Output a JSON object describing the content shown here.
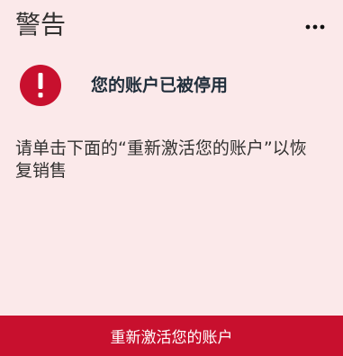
{
  "card": {
    "title": "警告",
    "more_icon": "more-horizontal-icon"
  },
  "alert": {
    "icon": "exclamation-icon",
    "heading": "您的账户已被停用",
    "icon_color": "#c8102e"
  },
  "message": {
    "text": "请单击下面的“重新激活您的账户”以恢复销售"
  },
  "action": {
    "label": "重新激活您的账户",
    "color": "#c8102e"
  },
  "colors": {
    "background": "#fbe9ea",
    "accent": "#c8102e",
    "heading_text": "#1f2d3a",
    "body_text": "#323130"
  }
}
